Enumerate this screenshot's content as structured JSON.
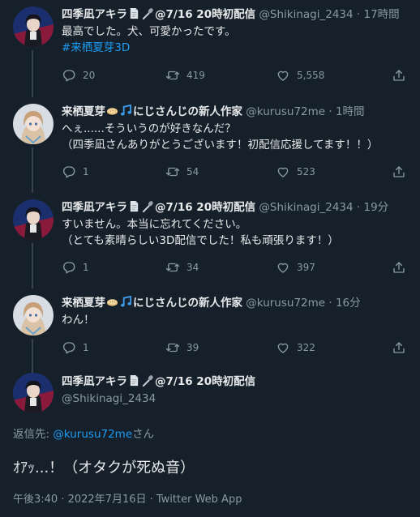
{
  "colors": {
    "background": "#15202b",
    "text": "#e7e9ea",
    "secondary": "#8b98a5",
    "accent": "#1d9bf0",
    "thread_line": "#38444d"
  },
  "tweets": [
    {
      "name": "四季凪アキラ",
      "suffix": "@7/16 20時初配信",
      "handle": "@Shikinagi_2434",
      "time": "· 17時間",
      "lines": [
        "最高でした。犬、可愛かったです。"
      ],
      "hashtag": "#来栖夏芽3D",
      "replies": "20",
      "retweets": "419",
      "likes": "5,558"
    },
    {
      "name": "来栖夏芽",
      "suffix": "にじさんじの新人作家",
      "handle": "@kurusu72me",
      "time": "· 1時間",
      "lines": [
        "へぇ......そういうのが好きなんだ？",
        "（四季凪さんありがとうございます！初配信応援してます！！）"
      ],
      "replies": "1",
      "retweets": "54",
      "likes": "523"
    },
    {
      "name": "四季凪アキラ",
      "suffix": "@7/16 20時初配信",
      "handle": "@Shikinagi_2434",
      "time": "· 19分",
      "lines": [
        "すいません。本当に忘れてください。",
        "（とても素晴らしい3D配信でした！私も頑張ります！）"
      ],
      "replies": "1",
      "retweets": "34",
      "likes": "397"
    },
    {
      "name": "来栖夏芽",
      "suffix": "にじさんじの新人作家",
      "handle": "@kurusu72me",
      "time": "· 16分",
      "lines": [
        "わん！"
      ],
      "replies": "1",
      "retweets": "39",
      "likes": "322"
    }
  ],
  "focused": {
    "name": "四季凪アキラ",
    "suffix": "@7/16 20時初配信",
    "handle": "@Shikinagi_2434",
    "reply_prefix": "返信先: ",
    "reply_mention": "@kurusu72me",
    "reply_suffix": "さん",
    "text": "ｵｱｯ...！（オタクが死ぬ音）",
    "meta": "午後3:40 · 2022年7月16日 · Twitter Web App"
  },
  "icons": [
    "reply-icon",
    "retweet-icon",
    "like-icon",
    "share-icon",
    "document-emoji",
    "microphone-emoji",
    "bread-emoji",
    "music-note-emoji"
  ]
}
